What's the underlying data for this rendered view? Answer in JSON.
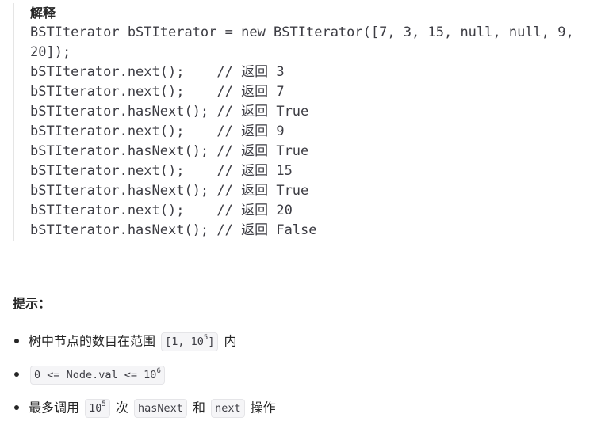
{
  "example": {
    "label": "解释",
    "lines": [
      "BSTIterator bSTIterator = new BSTIterator([7, 3, 15, null, null, 9,",
      "20]);",
      "bSTIterator.next();    // 返回 3",
      "bSTIterator.next();    // 返回 7",
      "bSTIterator.hasNext(); // 返回 True",
      "bSTIterator.next();    // 返回 9",
      "bSTIterator.hasNext(); // 返回 True",
      "bSTIterator.next();    // 返回 15",
      "bSTIterator.hasNext(); // 返回 True",
      "bSTIterator.next();    // 返回 20",
      "bSTIterator.hasNext(); // 返回 False"
    ]
  },
  "hints": {
    "title": "提示：",
    "items": [
      {
        "text_before": "树中节点的数目在范围",
        "code_base": "[1, 10",
        "code_sup": "5",
        "code_after": "]",
        "text_after": "内"
      },
      {
        "code_base": "0 <= Node.val <= 10",
        "code_sup": "6"
      },
      {
        "text_before": "最多调用",
        "code_base": "10",
        "code_sup": "5",
        "text_mid1": "次",
        "code2": "hasNext",
        "text_mid2": "和",
        "code3": "next",
        "text_after": "操作"
      }
    ]
  }
}
